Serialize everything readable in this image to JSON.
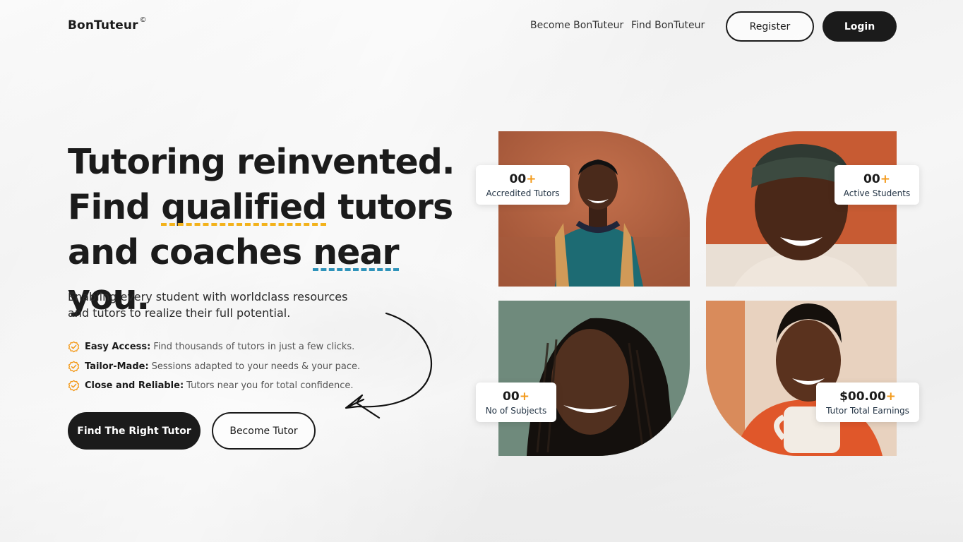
{
  "nav": {
    "logo": "BonTuteur",
    "logo_mark": "©",
    "links": [
      "Become BonTuteur",
      "Find BonTuteur"
    ],
    "register_label": "Register",
    "login_label": "Login"
  },
  "hero": {
    "title_line1": "Tutoring reinvented.",
    "title_line2_pre": "Find ",
    "title_line2_highlight": "qualified",
    "title_line2_post": " tutors",
    "title_line3_pre": "and coaches ",
    "title_line3_highlight": "near",
    "title_line3_post": " you.",
    "subtitle": "Enabling every student with worldclass resources and tutors to realize their full potential.",
    "features": [
      {
        "title": "Easy Access:",
        "text": "Find thousands of tutors in just a few clicks."
      },
      {
        "title": "Tailor-Made:",
        "text": "Sessions adapted to your needs & your pace."
      },
      {
        "title": "Close and Reliable:",
        "text": "Tutors near you for total confidence."
      }
    ],
    "primary_button": "Find The Right Tutor",
    "secondary_button": "Become Tutor"
  },
  "stats": [
    {
      "value": "00",
      "plus": "+",
      "label": "Accredited Tutors"
    },
    {
      "value": "00",
      "plus": "+",
      "label": "Active Students"
    },
    {
      "value": "00",
      "plus": "+",
      "label": "No of Subjects"
    },
    {
      "value": "$00.00",
      "plus": "+",
      "label": "Tutor Total Earnings"
    }
  ],
  "colors": {
    "primary": "#1b1b1b",
    "highlight_yellow": "#f3b21b",
    "highlight_blue": "#2e93ba",
    "stat_plus": "#f39a1b",
    "check_icon": "#f39a1b"
  },
  "icons": [
    "check-badge-icon",
    "curved-arrow-icon"
  ]
}
